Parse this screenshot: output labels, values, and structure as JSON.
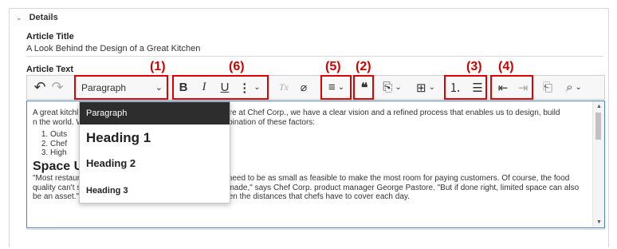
{
  "details": {
    "section_label": "Details",
    "chevron_glyph": "⌄",
    "article_title_label": "Article Title",
    "article_title_value": "A Look Behind the Design of a Great Kitchen",
    "article_text_label": "Article Text"
  },
  "callouts": [
    "(1)",
    "(6)",
    "(5)",
    "(2)",
    "(3)",
    "(4)"
  ],
  "toolbar": {
    "undo_glyph": "↶",
    "redo_glyph": "↷",
    "paragraph_select": "Paragraph",
    "dropdown_caret": "⌄",
    "bold": "B",
    "italic": "I",
    "underline": "U",
    "more_glyph": "⋮",
    "clear_format": "Tx",
    "link_glyph": "⌀",
    "align_glyph": "≡",
    "quote_glyph": "❝",
    "insert_glyph": "⎘",
    "table_glyph": "⊞",
    "ordered_list_glyph": "⒈",
    "unordered_list_glyph": "☰",
    "outdent_glyph": "⇤",
    "indent_glyph": "⇥",
    "paste_glyph": "⎗",
    "find_glyph": "⌕"
  },
  "editor": {
    "intro": "A great kitchl                                              onal chef? Here at Chef Corp., we have a clear vision and a refined process that enables us to design, build                                              n the world. What makes our kitchens so good is a combination of these factors:",
    "list_items": [
      "Outs",
      "Chef",
      "High"
    ],
    "heading": "Space U",
    "quote": "\"Most restaurants operate on a limited space. Kitchens need to be as small as feasible to make the most room for paying customers. Of course, the food quality can't suffer because of this. A tradeoff has to be made,\" says Chef Corp. product manager George Pastore. \"But if done right, limited space can also be an asset.\" This is because large kitchens also lengthen the distances that chefs have to cover each day.",
    "scroll_up": "▲",
    "scroll_down": "▼"
  },
  "paragraph_dropdown": {
    "items": [
      "Paragraph",
      "Heading 1",
      "Heading 2",
      "Heading 3"
    ],
    "selected": "Paragraph"
  }
}
